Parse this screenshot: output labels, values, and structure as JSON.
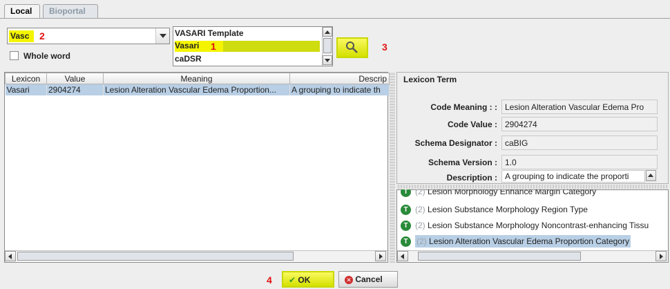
{
  "tabs": {
    "local": "Local",
    "bioportal": "Bioportal"
  },
  "search": {
    "combo_value": "Vasc",
    "marker": "2",
    "whole_word_label": "Whole word",
    "search_marker": "3"
  },
  "template_list": {
    "items": [
      "VASARI Template",
      "Vasari",
      "caDSR"
    ],
    "selected_marker": "1"
  },
  "results_table": {
    "columns": [
      "Lexicon",
      "Value",
      "Meaning",
      "Descrip"
    ],
    "rows": [
      {
        "lexicon": "Vasari",
        "value": "2904274",
        "meaning": "Lesion Alteration Vascular Edema Proportion...",
        "description": "A grouping to indicate th"
      }
    ]
  },
  "lexicon_term": {
    "title": "Lexicon Term",
    "code_meaning_label": "Code Meaning : :",
    "code_meaning": "Lesion Alteration Vascular Edema Pro",
    "code_value_label": "Code Value :",
    "code_value": "2904274",
    "schema_designator_label": "Schema Designator :",
    "schema_designator": "caBIG",
    "schema_version_label": "Schema Version :",
    "schema_version": "1.0",
    "description_label": "Description :",
    "description": "A grouping to indicate the proporti"
  },
  "tree": {
    "icon_letter": "T",
    "items": [
      {
        "count": "(2)",
        "label": "Lesion Morphology Enhance Margin Category"
      },
      {
        "count": "(2)",
        "label": "Lesion Substance Morphology Region Type"
      },
      {
        "count": "(2)",
        "label": "Lesion Substance Morphology Noncontrast-enhancing Tissu"
      },
      {
        "count": "(2)",
        "label": "Lesion Alteration Vascular Edema Proportion Category"
      }
    ]
  },
  "footer": {
    "marker": "4",
    "ok_label": "OK",
    "cancel_label": "Cancel"
  },
  "colors": {
    "highlight": "#f4f400",
    "selection": "#b8cfe5",
    "icon_green": "#2a8a3a",
    "marker_red": "#e01010"
  }
}
